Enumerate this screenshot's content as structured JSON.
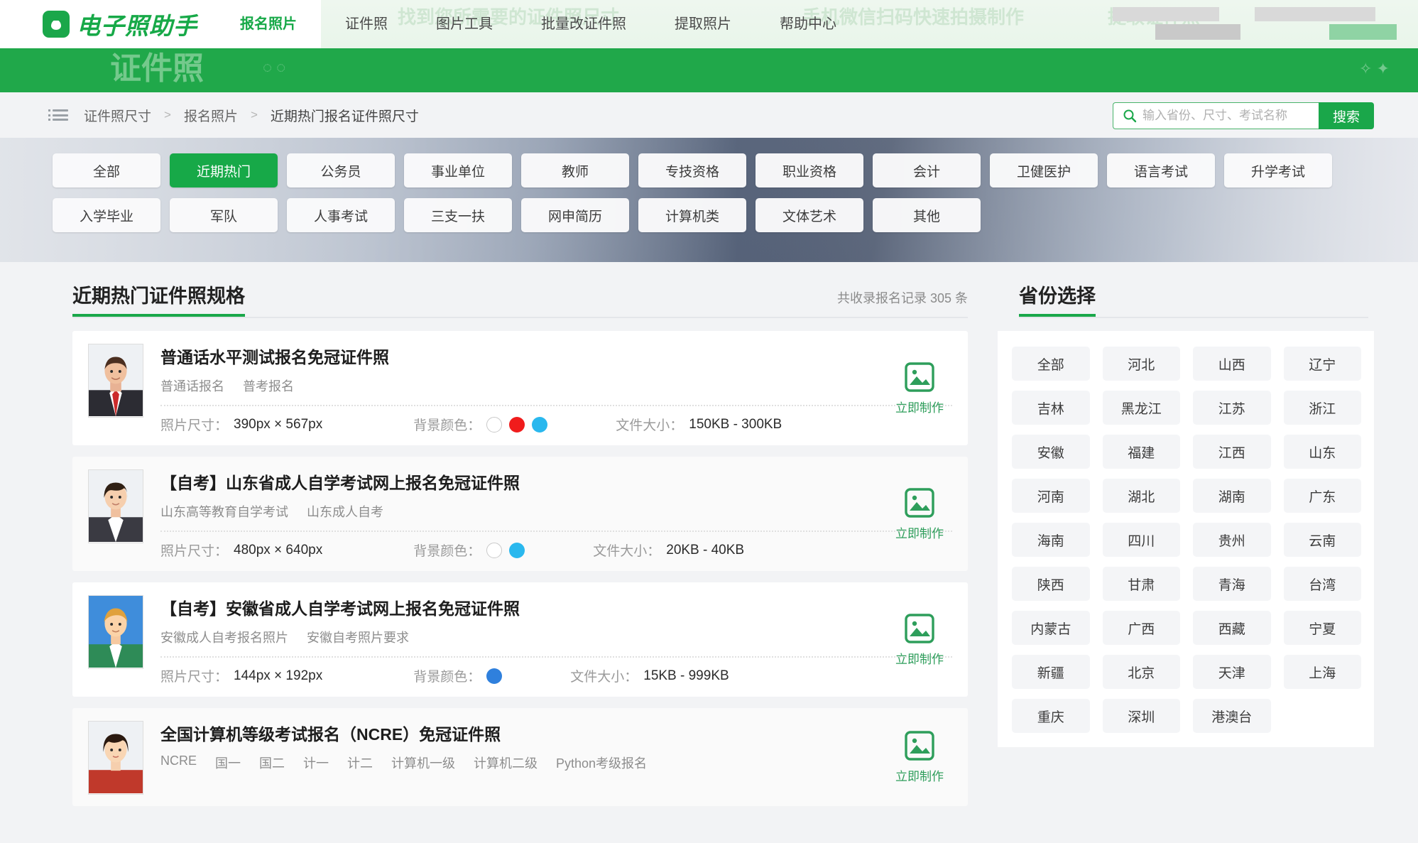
{
  "site": {
    "logo_text": "电子照助手",
    "logo_icon": "camera-icon"
  },
  "nav": {
    "items": [
      {
        "label": "报名照片",
        "active": true
      },
      {
        "label": "证件照",
        "active": false
      },
      {
        "label": "图片工具",
        "active": false
      },
      {
        "label": "批量改证件照",
        "active": false
      },
      {
        "label": "提取照片",
        "active": false
      },
      {
        "label": "帮助中心",
        "active": false
      }
    ]
  },
  "banner": {
    "title": "证件照",
    "ghost_lines": [
      "找到您所需要的证件照尺寸",
      "手机微信扫码快速拍摄制作",
      "提取证件照"
    ]
  },
  "breadcrumb": {
    "icon": "list-icon",
    "items": [
      "证件照尺寸",
      "报名照片",
      "近期热门报名证件照尺寸"
    ],
    "separator": ">"
  },
  "search": {
    "icon": "search-icon",
    "placeholder": "输入省份、尺寸、考试名称",
    "value": "",
    "button_label": "搜索"
  },
  "categories": {
    "row1": [
      {
        "label": "全部",
        "active": false
      },
      {
        "label": "近期热门",
        "active": true
      },
      {
        "label": "公务员",
        "active": false
      },
      {
        "label": "事业单位",
        "active": false
      },
      {
        "label": "教师",
        "active": false
      },
      {
        "label": "专技资格",
        "active": false
      },
      {
        "label": "职业资格",
        "active": false
      },
      {
        "label": "会计",
        "active": false
      },
      {
        "label": "卫健医护",
        "active": false
      },
      {
        "label": "语言考试",
        "active": false
      },
      {
        "label": "升学考试",
        "active": false
      }
    ],
    "row2": [
      {
        "label": "入学毕业",
        "active": false
      },
      {
        "label": "军队",
        "active": false
      },
      {
        "label": "人事考试",
        "active": false
      },
      {
        "label": "三支一扶",
        "active": false
      },
      {
        "label": "网申简历",
        "active": false
      },
      {
        "label": "计算机类",
        "active": false
      },
      {
        "label": "文体艺术",
        "active": false
      },
      {
        "label": "其他",
        "active": false
      }
    ]
  },
  "main": {
    "title": "近期热门证件照规格",
    "count_text": "共收录报名记录 305 条",
    "labels": {
      "size": "照片尺寸：",
      "bg": "背景颜色：",
      "file": "文件大小："
    },
    "make_label": "立即制作",
    "make_icon": "image-icon",
    "cards": [
      {
        "title": "普通话水平测试报名免冠证件照",
        "tags": [
          "普通话报名",
          "普考报名"
        ],
        "size": "390px × 567px",
        "colors": [
          "white",
          "red",
          "blue"
        ],
        "filesize": "150KB - 300KB",
        "avatar": "man-suit-red-tie"
      },
      {
        "title": "【自考】山东省成人自学考试网上报名免冠证件照",
        "tags": [
          "山东高等教育自学考试",
          "山东成人自考"
        ],
        "size": "480px × 640px",
        "colors": [
          "white",
          "blue"
        ],
        "filesize": "20KB - 40KB",
        "avatar": "woman-dark-hair"
      },
      {
        "title": "【自考】安徽省成人自学考试网上报名免冠证件照",
        "tags": [
          "安徽成人自考报名照片",
          "安徽自考照片要求"
        ],
        "size": "144px × 192px",
        "colors": [
          "dblue"
        ],
        "filesize": "15KB - 999KB",
        "avatar": "man-blond-green"
      },
      {
        "title": "全国计算机等级考试报名（NCRE）免冠证件照",
        "tags": [
          "NCRE",
          "国一",
          "国二",
          "计一",
          "计二",
          "计算机一级",
          "计算机二级",
          "Python考级报名"
        ],
        "size": "",
        "colors": [],
        "filesize": "",
        "avatar": "woman-red-top"
      }
    ]
  },
  "provinces": {
    "title": "省份选择",
    "items": [
      "全部",
      "河北",
      "山西",
      "辽宁",
      "吉林",
      "黑龙江",
      "江苏",
      "浙江",
      "安徽",
      "福建",
      "江西",
      "山东",
      "河南",
      "湖北",
      "湖南",
      "广东",
      "海南",
      "四川",
      "贵州",
      "云南",
      "陕西",
      "甘肃",
      "青海",
      "台湾",
      "内蒙古",
      "广西",
      "西藏",
      "宁夏",
      "新疆",
      "北京",
      "天津",
      "上海",
      "重庆",
      "深圳",
      "港澳台"
    ]
  },
  "colors": {
    "brand_green": "#1aa74a",
    "banner_green": "#20a84a",
    "page_bg": "#f2f3f5",
    "swatch_red": "#f01c1c",
    "swatch_blue": "#2ab8ee",
    "swatch_dblue": "#2f80dd"
  }
}
